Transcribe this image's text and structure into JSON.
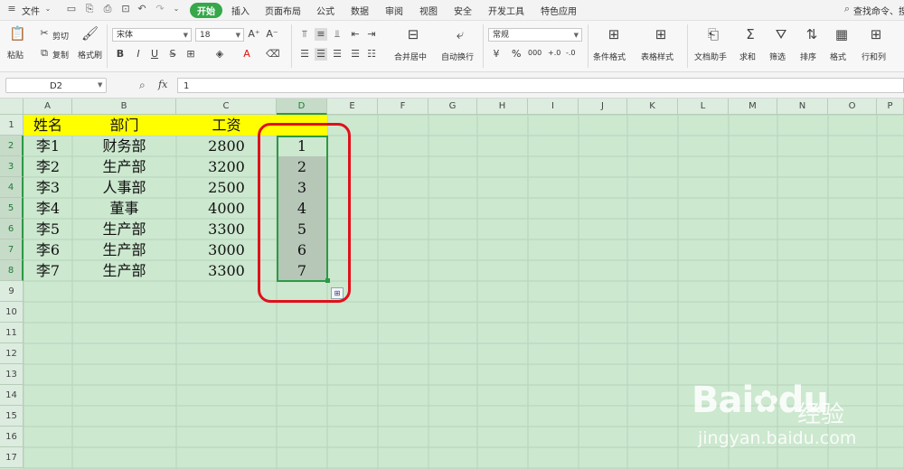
{
  "menubar": {
    "file_label": "文件",
    "tabs": [
      "开始",
      "插入",
      "页面布局",
      "公式",
      "数据",
      "审阅",
      "视图",
      "安全",
      "开发工具",
      "特色应用"
    ],
    "active_tab": "开始",
    "search_label": "查找命令、搜"
  },
  "ribbon": {
    "paste": "粘贴",
    "cut": "剪切",
    "copy": "复制",
    "format_painter": "格式刷",
    "font_name": "宋体",
    "font_size": "18",
    "merge_center": "合并居中",
    "wrap_text": "自动换行",
    "number_format": "常规",
    "conditional_format": "条件格式",
    "table_style": "表格样式",
    "doc_assistant": "文档助手",
    "sum": "求和",
    "filter": "筛选",
    "sort": "排序",
    "format": "格式",
    "rows_cols": "行和列",
    "percent": "%",
    "thousand": "000",
    "dec_inc": "+.0",
    "dec_dec": "-.0"
  },
  "formula_bar": {
    "name_box": "D2",
    "fx_label": "fx",
    "content": "1"
  },
  "sheet": {
    "columns": [
      "A",
      "B",
      "C",
      "D",
      "E",
      "F",
      "G",
      "H",
      "I",
      "J",
      "K",
      "L",
      "M",
      "N",
      "O",
      "P"
    ],
    "rows": [
      "1",
      "2",
      "3",
      "4",
      "5",
      "6",
      "7",
      "8",
      "9",
      "10",
      "11",
      "12",
      "13",
      "14",
      "15",
      "16",
      "17"
    ],
    "header": [
      "姓名",
      "部门",
      "工资"
    ],
    "data": [
      [
        "李1",
        "财务部",
        "2800",
        "1"
      ],
      [
        "李2",
        "生产部",
        "3200",
        "2"
      ],
      [
        "李3",
        "人事部",
        "2500",
        "3"
      ],
      [
        "李4",
        "董事",
        "4000",
        "4"
      ],
      [
        "李5",
        "生产部",
        "3300",
        "5"
      ],
      [
        "李6",
        "生产部",
        "3000",
        "6"
      ],
      [
        "李7",
        "生产部",
        "3300",
        "7"
      ]
    ],
    "selected_column": "D",
    "header_fill": "#ffff00",
    "selection_color": "#2b9a45",
    "annotation_color": "#e0101c"
  },
  "watermark": {
    "brand": "Bai",
    "brand2": "du",
    "product": "经验",
    "url": "jingyan.baidu.com"
  }
}
